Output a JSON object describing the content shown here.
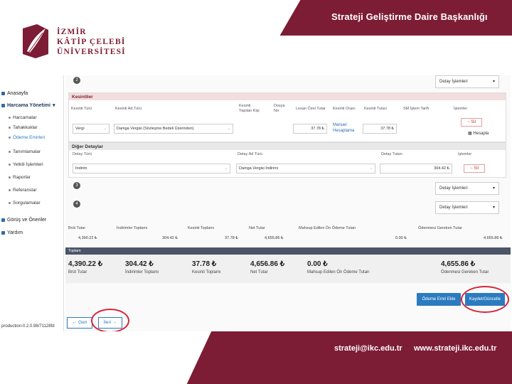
{
  "header": {
    "title": "Strateji Geliştirme Daire Başkanlığı",
    "logo_lines": [
      "İZMİR",
      "KÂTİP ÇELEBİ",
      "ÜNİVERSİTESİ"
    ]
  },
  "sidebar": {
    "items": [
      {
        "label": "Anasayfa"
      },
      {
        "label": "Harcama Yönetimi"
      },
      {
        "label": "Tanımlamalar"
      },
      {
        "label": "Yetkili İşlemleri"
      },
      {
        "label": "Raporlar"
      },
      {
        "label": "Referanslar"
      },
      {
        "label": "Sorgulamalar"
      },
      {
        "label": "Görüş ve Öneriler"
      },
      {
        "label": "Yardım"
      }
    ],
    "subitems": [
      "Harcamalar",
      "Tahakkuklar",
      "Ödeme Emirleri"
    ],
    "version": "production-0.2.0.98/71128fd"
  },
  "steps": {
    "step2": "2",
    "step3": "3",
    "step4": "4",
    "detail_label": "Detay İşlemleri"
  },
  "kesintiler": {
    "title": "Kesintiler",
    "columns": [
      "Kesinti Türü",
      "Kesinti Ad Türü",
      "Kesinti Yapılan Kişi",
      "Dosya No",
      "Lesan Özel Tutar",
      "Kesinti Oranı",
      "Kesinti Tutarı",
      "SM İşlem Tarifi",
      "İşlemler"
    ],
    "row": {
      "type": "Vergi",
      "name": "Damga Vergisi (Sözleşme Bedeli Üzerinden)",
      "base": "37.78",
      "link": "Manuel Hesaplama",
      "amount": "37.78",
      "remove": "Sil",
      "calc": "Hesapla"
    }
  },
  "diger": {
    "title": "Diğer Detaylar",
    "columns": [
      "Detay Türü",
      "Detay Ad Türü",
      "Detay Tutarı",
      "İşlemler"
    ],
    "row": {
      "type": "İndirim",
      "name": "Damga Vergisi İndirimi",
      "amount": "304.42",
      "remove": "Sil"
    }
  },
  "totals": {
    "headers": [
      "Brüt Tutar",
      "İndirimler Toplamı",
      "Kesinti Toplamı",
      "Net Tutar",
      "Mahsup Edilen Ön Ödeme Tutarı",
      "Ödenmesi Gereken Tutar"
    ],
    "values": [
      "4,390.22 ₺",
      "304.42 ₺",
      "37.78 ₺",
      "4,655.86 ₺",
      "0.00 ₺",
      "4,655.86 ₺"
    ]
  },
  "summary": {
    "title": "Toplam",
    "values": [
      "4,390.22 ₺",
      "304.42 ₺",
      "37.78 ₺",
      "4,656.86 ₺",
      "0.00 ₺",
      "4,655.86 ₺"
    ],
    "labels": [
      "Brüt Tutar",
      "İndirimler Toplamı",
      "Kesinti Toplamı",
      "Net Tutar",
      "Mahsup Edilen Ön Ödeme Tutarı",
      "Ödenmesi Gereken Tutar"
    ]
  },
  "actions": {
    "odeme_emri": "Ödeme Emri Ekle",
    "kaydet": "Kaydet/Güncelle",
    "geri": "Geri",
    "ileri": "İleri"
  },
  "footer": {
    "email": "strateji@ikc.edu.tr",
    "web": "www.strateji.ikc.edu.tr"
  },
  "colors": {
    "brand": "#7d1c35",
    "accent": "#2b7bbf",
    "annotation": "#d6243a"
  }
}
